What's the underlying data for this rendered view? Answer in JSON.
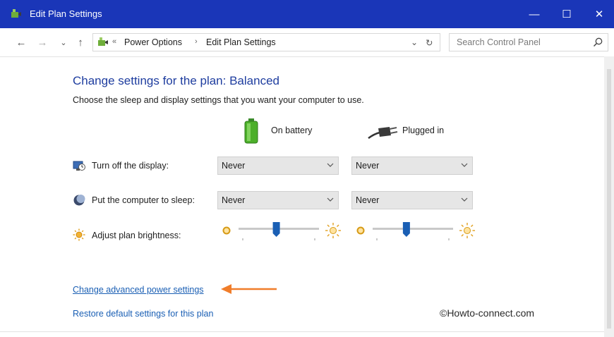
{
  "window": {
    "title": "Edit Plan Settings",
    "controls": {
      "minimize": "—",
      "maximize": "☐",
      "close": "✕"
    }
  },
  "addressbar": {
    "back": "←",
    "forward": "→",
    "recent": "⌄",
    "up": "↑",
    "overflow": "«",
    "breadcrumbs": [
      "Power Options",
      "Edit Plan Settings"
    ],
    "separator": "›",
    "dropdown": "⌄",
    "refresh": "↻",
    "search_placeholder": "Search Control Panel"
  },
  "main": {
    "heading": "Change settings for the plan: Balanced",
    "subheading": "Choose the sleep and display settings that you want your computer to use.",
    "columns": {
      "battery": "On battery",
      "plugged": "Plugged in"
    },
    "rows": [
      {
        "label": "Turn off the display:",
        "battery": "Never",
        "plugged": "Never"
      },
      {
        "label": "Put the computer to sleep:",
        "battery": "Never",
        "plugged": "Never"
      }
    ],
    "brightness": {
      "label": "Adjust plan brightness:",
      "battery_level": 0.47,
      "plugged_level": 0.42
    },
    "links": {
      "advanced": "Change advanced power settings",
      "restore": "Restore default settings for this plan"
    },
    "watermark": "©Howto-connect.com"
  },
  "colors": {
    "titlebar": "#1a36b8",
    "heading": "#1e3d9f",
    "link": "#1a5fb4",
    "slider_thumb": "#1a5fb4",
    "arrow": "#f07d2a"
  }
}
